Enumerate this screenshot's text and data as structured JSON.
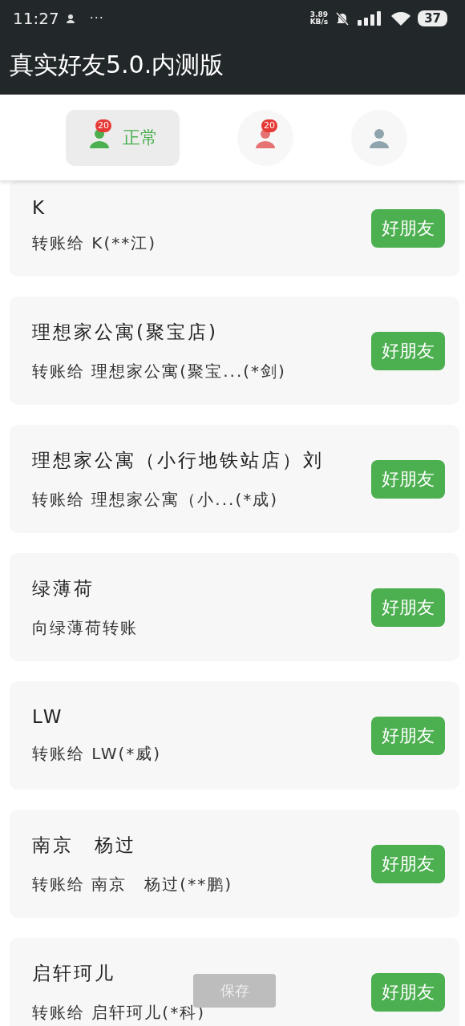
{
  "status_bar": {
    "time": "11:27",
    "more": "···",
    "speed_value": "3.89",
    "speed_unit": "KB/s",
    "battery": "37"
  },
  "app_bar": {
    "title": "真实好友5.0.内测版"
  },
  "tabs": [
    {
      "label": "正常",
      "badge": "20",
      "color": "#4caf50",
      "selected": true
    },
    {
      "badge": "20",
      "color": "#e57373",
      "selected": false
    },
    {
      "color": "#90a4ae",
      "selected": false
    }
  ],
  "contacts": [
    {
      "name": "K",
      "note": "转账给 K(**江)",
      "action": "好朋友"
    },
    {
      "name": "理想家公寓(聚宝店)",
      "note": "转账给 理想家公寓(聚宝...(*剑)",
      "action": "好朋友"
    },
    {
      "name": "理想家公寓（小行地铁站店）刘",
      "note": "转账给 理想家公寓（小...(*成)",
      "action": "好朋友"
    },
    {
      "name": "绿薄荷",
      "note": "向绿薄荷转账",
      "action": "好朋友"
    },
    {
      "name": "LW",
      "note": "转账给 LW(*威)",
      "action": "好朋友"
    },
    {
      "name": "南京　杨过",
      "note": "转账给 南京　杨过(**鹏)",
      "action": "好朋友"
    },
    {
      "name": "启轩珂儿",
      "note": "转账给 启轩珂儿(*科)",
      "action": "好朋友"
    }
  ],
  "save_button": {
    "label": "保存",
    "disabled": true
  }
}
